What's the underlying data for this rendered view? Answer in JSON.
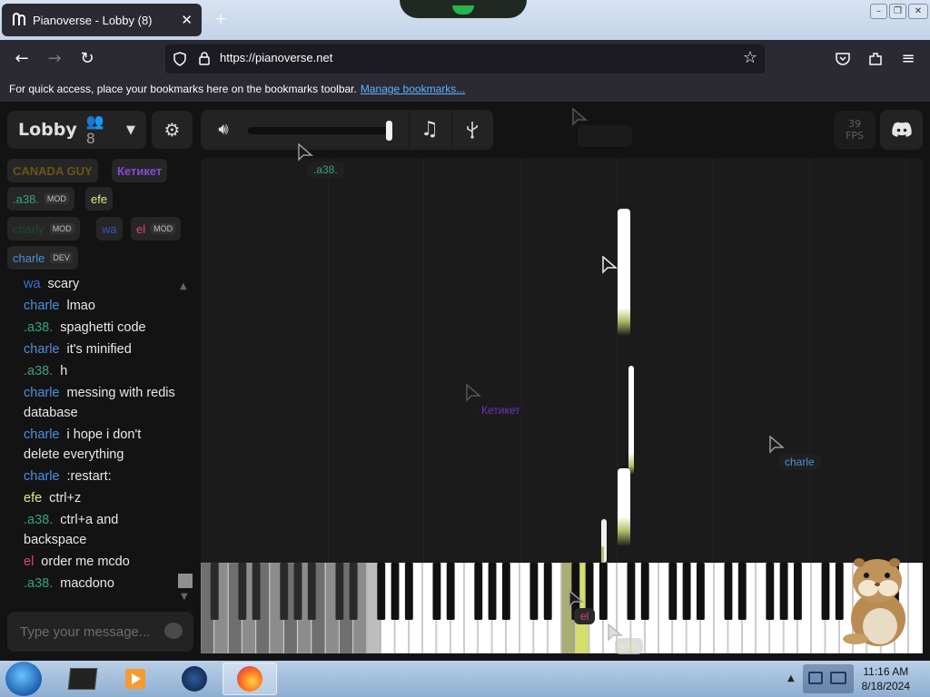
{
  "browser": {
    "tab_title": "Pianoverse - Lobby (8)",
    "tab_close": "✕",
    "new_tab": "+",
    "url": "https://pianoverse.net",
    "bookmarks_hint": "For quick access, place your bookmarks here on the bookmarks toolbar.",
    "bookmarks_link": "Manage bookmarks..."
  },
  "room": {
    "name": "Lobby",
    "user_count": "8"
  },
  "users": [
    {
      "name": "CANADA GUY",
      "color": "#6b5417",
      "badge": ""
    },
    {
      "name": "Кетикет",
      "color": "#8a49d6",
      "badge": ""
    },
    {
      "name": ".a38.",
      "color": "#3aa179",
      "badge": "MOD"
    },
    {
      "name": "efe",
      "color": "#e3e88a",
      "badge": ""
    },
    {
      "name": "charly",
      "color": "#1f4a2c",
      "badge": "MOD"
    },
    {
      "name": "wa",
      "color": "#2f57b3",
      "badge": ""
    },
    {
      "name": "el",
      "color": "#e2446b",
      "badge": "MOD"
    },
    {
      "name": "charle",
      "color": "#4d8fe0",
      "badge": "DEV"
    }
  ],
  "chat": [
    {
      "user": "wa",
      "color": "#3d6fd9",
      "text": "scary"
    },
    {
      "user": "charle",
      "color": "#4d8fe0",
      "text": "lmao"
    },
    {
      "user": ".a38.",
      "color": "#3aa179",
      "text": "spaghetti code"
    },
    {
      "user": "charle",
      "color": "#4d8fe0",
      "text": "it's minified"
    },
    {
      "user": ".a38.",
      "color": "#3aa179",
      "text": "h"
    },
    {
      "user": "charle",
      "color": "#4d8fe0",
      "text": "messing with redis database"
    },
    {
      "user": "charle",
      "color": "#4d8fe0",
      "text": "i hope i don't delete everything"
    },
    {
      "user": "charle",
      "color": "#4d8fe0",
      "text": ":restart:"
    },
    {
      "user": "efe",
      "color": "#e3e88a",
      "text": "ctrl+z"
    },
    {
      "user": ".a38.",
      "color": "#3aa179",
      "text": "ctrl+a and backspace"
    },
    {
      "user": "el",
      "color": "#e2446b",
      "text": "order me mcdo"
    },
    {
      "user": ".a38.",
      "color": "#3aa179",
      "text": "macdono"
    }
  ],
  "chat_input": {
    "placeholder": "Type your message..."
  },
  "toolbar": {
    "volume_icon": "volume-icon",
    "volume_level": 0.98,
    "music_icon": "music-note-icon",
    "usb_icon": "usb-icon"
  },
  "fps": {
    "value": "39",
    "label": "FPS"
  },
  "cursors": [
    {
      "name": ".a38.",
      "color": "#3aa179"
    },
    {
      "name": "Кетикет",
      "color": "#6a3aa8"
    },
    {
      "name": "charle",
      "color": "#4d8fe0"
    },
    {
      "name": "el",
      "color": "#e2446b"
    },
    {
      "name": "efe",
      "color": "#e3e88a"
    }
  ],
  "taskbar": {
    "time": "11:16 AM",
    "date": "8/18/2024"
  }
}
